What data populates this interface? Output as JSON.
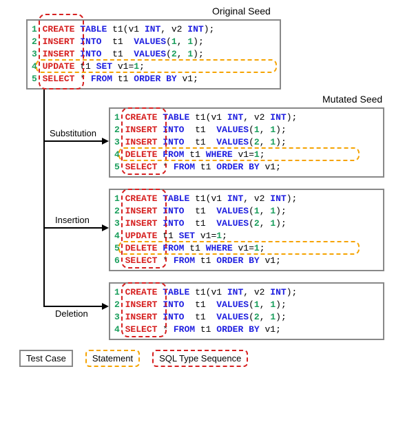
{
  "labels": {
    "original": "Original Seed",
    "mutated": "Mutated Seed",
    "substitution": "Substitution",
    "insertion": "Insertion",
    "deletion": "Deletion"
  },
  "legend": {
    "testcase": "Test Case",
    "statement": "Statement",
    "typeseq": "SQL Type Sequence"
  },
  "original": {
    "lines": [
      {
        "n": "1",
        "cmd": "CREATE",
        "body": [
          {
            "t": " ",
            "c": "plain"
          },
          {
            "t": "TABLE",
            "c": "kw-blue"
          },
          {
            "t": " t1(v1 ",
            "c": "plain"
          },
          {
            "t": "INT",
            "c": "kw-blue"
          },
          {
            "t": ", v2 ",
            "c": "plain"
          },
          {
            "t": "INT",
            "c": "kw-blue"
          },
          {
            "t": ");",
            "c": "plain"
          }
        ]
      },
      {
        "n": "2",
        "cmd": "INSERT",
        "body": [
          {
            "t": " ",
            "c": "plain"
          },
          {
            "t": "INTO",
            "c": "kw-blue"
          },
          {
            "t": "  t1  ",
            "c": "plain"
          },
          {
            "t": "VALUES",
            "c": "kw-blue"
          },
          {
            "t": "(",
            "c": "plain"
          },
          {
            "t": "1",
            "c": "num"
          },
          {
            "t": ", ",
            "c": "plain"
          },
          {
            "t": "1",
            "c": "num"
          },
          {
            "t": ");",
            "c": "plain"
          }
        ]
      },
      {
        "n": "3",
        "cmd": "INSERT",
        "body": [
          {
            "t": " ",
            "c": "plain"
          },
          {
            "t": "INTO",
            "c": "kw-blue"
          },
          {
            "t": "  t1  ",
            "c": "plain"
          },
          {
            "t": "VALUES",
            "c": "kw-blue"
          },
          {
            "t": "(",
            "c": "plain"
          },
          {
            "t": "2",
            "c": "num"
          },
          {
            "t": ", ",
            "c": "plain"
          },
          {
            "t": "1",
            "c": "num"
          },
          {
            "t": ");",
            "c": "plain"
          }
        ]
      },
      {
        "n": "4",
        "cmd": "UPDATE",
        "body": [
          {
            "t": " t1 ",
            "c": "plain"
          },
          {
            "t": "SET",
            "c": "kw-blue"
          },
          {
            "t": " v1=",
            "c": "plain"
          },
          {
            "t": "1",
            "c": "num"
          },
          {
            "t": ";",
            "c": "plain"
          }
        ]
      },
      {
        "n": "5",
        "cmd": "SELECT",
        "body": [
          {
            "t": " * ",
            "c": "plain"
          },
          {
            "t": "FROM",
            "c": "kw-blue"
          },
          {
            "t": " t1 ",
            "c": "plain"
          },
          {
            "t": "ORDER BY",
            "c": "kw-blue"
          },
          {
            "t": " v1;",
            "c": "plain"
          }
        ]
      }
    ]
  },
  "substitution": {
    "lines": [
      {
        "n": "1",
        "cmd": "CREATE",
        "body": [
          {
            "t": " ",
            "c": "plain"
          },
          {
            "t": "TABLE",
            "c": "kw-blue"
          },
          {
            "t": " t1(v1 ",
            "c": "plain"
          },
          {
            "t": "INT",
            "c": "kw-blue"
          },
          {
            "t": ", v2 ",
            "c": "plain"
          },
          {
            "t": "INT",
            "c": "kw-blue"
          },
          {
            "t": ");",
            "c": "plain"
          }
        ]
      },
      {
        "n": "2",
        "cmd": "INSERT",
        "body": [
          {
            "t": " ",
            "c": "plain"
          },
          {
            "t": "INTO",
            "c": "kw-blue"
          },
          {
            "t": "  t1  ",
            "c": "plain"
          },
          {
            "t": "VALUES",
            "c": "kw-blue"
          },
          {
            "t": "(",
            "c": "plain"
          },
          {
            "t": "1",
            "c": "num"
          },
          {
            "t": ", ",
            "c": "plain"
          },
          {
            "t": "1",
            "c": "num"
          },
          {
            "t": ");",
            "c": "plain"
          }
        ]
      },
      {
        "n": "3",
        "cmd": "INSERT",
        "body": [
          {
            "t": " ",
            "c": "plain"
          },
          {
            "t": "INTO",
            "c": "kw-blue"
          },
          {
            "t": "  t1  ",
            "c": "plain"
          },
          {
            "t": "VALUES",
            "c": "kw-blue"
          },
          {
            "t": "(",
            "c": "plain"
          },
          {
            "t": "2",
            "c": "num"
          },
          {
            "t": ", ",
            "c": "plain"
          },
          {
            "t": "1",
            "c": "num"
          },
          {
            "t": ");",
            "c": "plain"
          }
        ]
      },
      {
        "n": "4",
        "cmd": "DELETE",
        "body": [
          {
            "t": " ",
            "c": "plain"
          },
          {
            "t": "FROM",
            "c": "kw-blue"
          },
          {
            "t": " t1 ",
            "c": "plain"
          },
          {
            "t": "WHERE",
            "c": "kw-blue"
          },
          {
            "t": " v1=",
            "c": "plain"
          },
          {
            "t": "1",
            "c": "num"
          },
          {
            "t": ";",
            "c": "plain"
          }
        ]
      },
      {
        "n": "5",
        "cmd": "SELECT",
        "body": [
          {
            "t": " * ",
            "c": "plain"
          },
          {
            "t": "FROM",
            "c": "kw-blue"
          },
          {
            "t": " t1 ",
            "c": "plain"
          },
          {
            "t": "ORDER BY",
            "c": "kw-blue"
          },
          {
            "t": " v1;",
            "c": "plain"
          }
        ]
      }
    ]
  },
  "insertion": {
    "lines": [
      {
        "n": "1",
        "cmd": "CREATE",
        "body": [
          {
            "t": " ",
            "c": "plain"
          },
          {
            "t": "TABLE",
            "c": "kw-blue"
          },
          {
            "t": " t1(v1 ",
            "c": "plain"
          },
          {
            "t": "INT",
            "c": "kw-blue"
          },
          {
            "t": ", v2 ",
            "c": "plain"
          },
          {
            "t": "INT",
            "c": "kw-blue"
          },
          {
            "t": ");",
            "c": "plain"
          }
        ]
      },
      {
        "n": "2",
        "cmd": "INSERT",
        "body": [
          {
            "t": " ",
            "c": "plain"
          },
          {
            "t": "INTO",
            "c": "kw-blue"
          },
          {
            "t": "  t1  ",
            "c": "plain"
          },
          {
            "t": "VALUES",
            "c": "kw-blue"
          },
          {
            "t": "(",
            "c": "plain"
          },
          {
            "t": "1",
            "c": "num"
          },
          {
            "t": ", ",
            "c": "plain"
          },
          {
            "t": "1",
            "c": "num"
          },
          {
            "t": ");",
            "c": "plain"
          }
        ]
      },
      {
        "n": "3",
        "cmd": "INSERT",
        "body": [
          {
            "t": " ",
            "c": "plain"
          },
          {
            "t": "INTO",
            "c": "kw-blue"
          },
          {
            "t": "  t1  ",
            "c": "plain"
          },
          {
            "t": "VALUES",
            "c": "kw-blue"
          },
          {
            "t": "(",
            "c": "plain"
          },
          {
            "t": "2",
            "c": "num"
          },
          {
            "t": ", ",
            "c": "plain"
          },
          {
            "t": "1",
            "c": "num"
          },
          {
            "t": ");",
            "c": "plain"
          }
        ]
      },
      {
        "n": "4",
        "cmd": "UPDATE",
        "body": [
          {
            "t": " t1 ",
            "c": "plain"
          },
          {
            "t": "SET",
            "c": "kw-blue"
          },
          {
            "t": " v1=",
            "c": "plain"
          },
          {
            "t": "1",
            "c": "num"
          },
          {
            "t": ";",
            "c": "plain"
          }
        ]
      },
      {
        "n": "5",
        "cmd": "DELETE",
        "body": [
          {
            "t": " ",
            "c": "plain"
          },
          {
            "t": "FROM",
            "c": "kw-blue"
          },
          {
            "t": " t1 ",
            "c": "plain"
          },
          {
            "t": "WHERE",
            "c": "kw-blue"
          },
          {
            "t": " v1=",
            "c": "plain"
          },
          {
            "t": "1",
            "c": "num"
          },
          {
            "t": ";",
            "c": "plain"
          }
        ]
      },
      {
        "n": "6",
        "cmd": "SELECT",
        "body": [
          {
            "t": " * ",
            "c": "plain"
          },
          {
            "t": "FROM",
            "c": "kw-blue"
          },
          {
            "t": " t1 ",
            "c": "plain"
          },
          {
            "t": "ORDER BY",
            "c": "kw-blue"
          },
          {
            "t": " v1;",
            "c": "plain"
          }
        ]
      }
    ]
  },
  "deletion": {
    "lines": [
      {
        "n": "1",
        "cmd": "CREATE",
        "body": [
          {
            "t": " ",
            "c": "plain"
          },
          {
            "t": "TABLE",
            "c": "kw-blue"
          },
          {
            "t": " t1(v1 ",
            "c": "plain"
          },
          {
            "t": "INT",
            "c": "kw-blue"
          },
          {
            "t": ", v2 ",
            "c": "plain"
          },
          {
            "t": "INT",
            "c": "kw-blue"
          },
          {
            "t": ");",
            "c": "plain"
          }
        ]
      },
      {
        "n": "2",
        "cmd": "INSERT",
        "body": [
          {
            "t": " ",
            "c": "plain"
          },
          {
            "t": "INTO",
            "c": "kw-blue"
          },
          {
            "t": "  t1  ",
            "c": "plain"
          },
          {
            "t": "VALUES",
            "c": "kw-blue"
          },
          {
            "t": "(",
            "c": "plain"
          },
          {
            "t": "1",
            "c": "num"
          },
          {
            "t": ", ",
            "c": "plain"
          },
          {
            "t": "1",
            "c": "num"
          },
          {
            "t": ");",
            "c": "plain"
          }
        ]
      },
      {
        "n": "3",
        "cmd": "INSERT",
        "body": [
          {
            "t": " ",
            "c": "plain"
          },
          {
            "t": "INTO",
            "c": "kw-blue"
          },
          {
            "t": "  t1  ",
            "c": "plain"
          },
          {
            "t": "VALUES",
            "c": "kw-blue"
          },
          {
            "t": "(",
            "c": "plain"
          },
          {
            "t": "2",
            "c": "num"
          },
          {
            "t": ", ",
            "c": "plain"
          },
          {
            "t": "1",
            "c": "num"
          },
          {
            "t": ");",
            "c": "plain"
          }
        ]
      },
      {
        "n": "4",
        "cmd": "SELECT",
        "body": [
          {
            "t": " * ",
            "c": "plain"
          },
          {
            "t": "FROM",
            "c": "kw-blue"
          },
          {
            "t": " t1 ",
            "c": "plain"
          },
          {
            "t": "ORDER BY",
            "c": "kw-blue"
          },
          {
            "t": " v1;",
            "c": "plain"
          }
        ]
      }
    ]
  }
}
